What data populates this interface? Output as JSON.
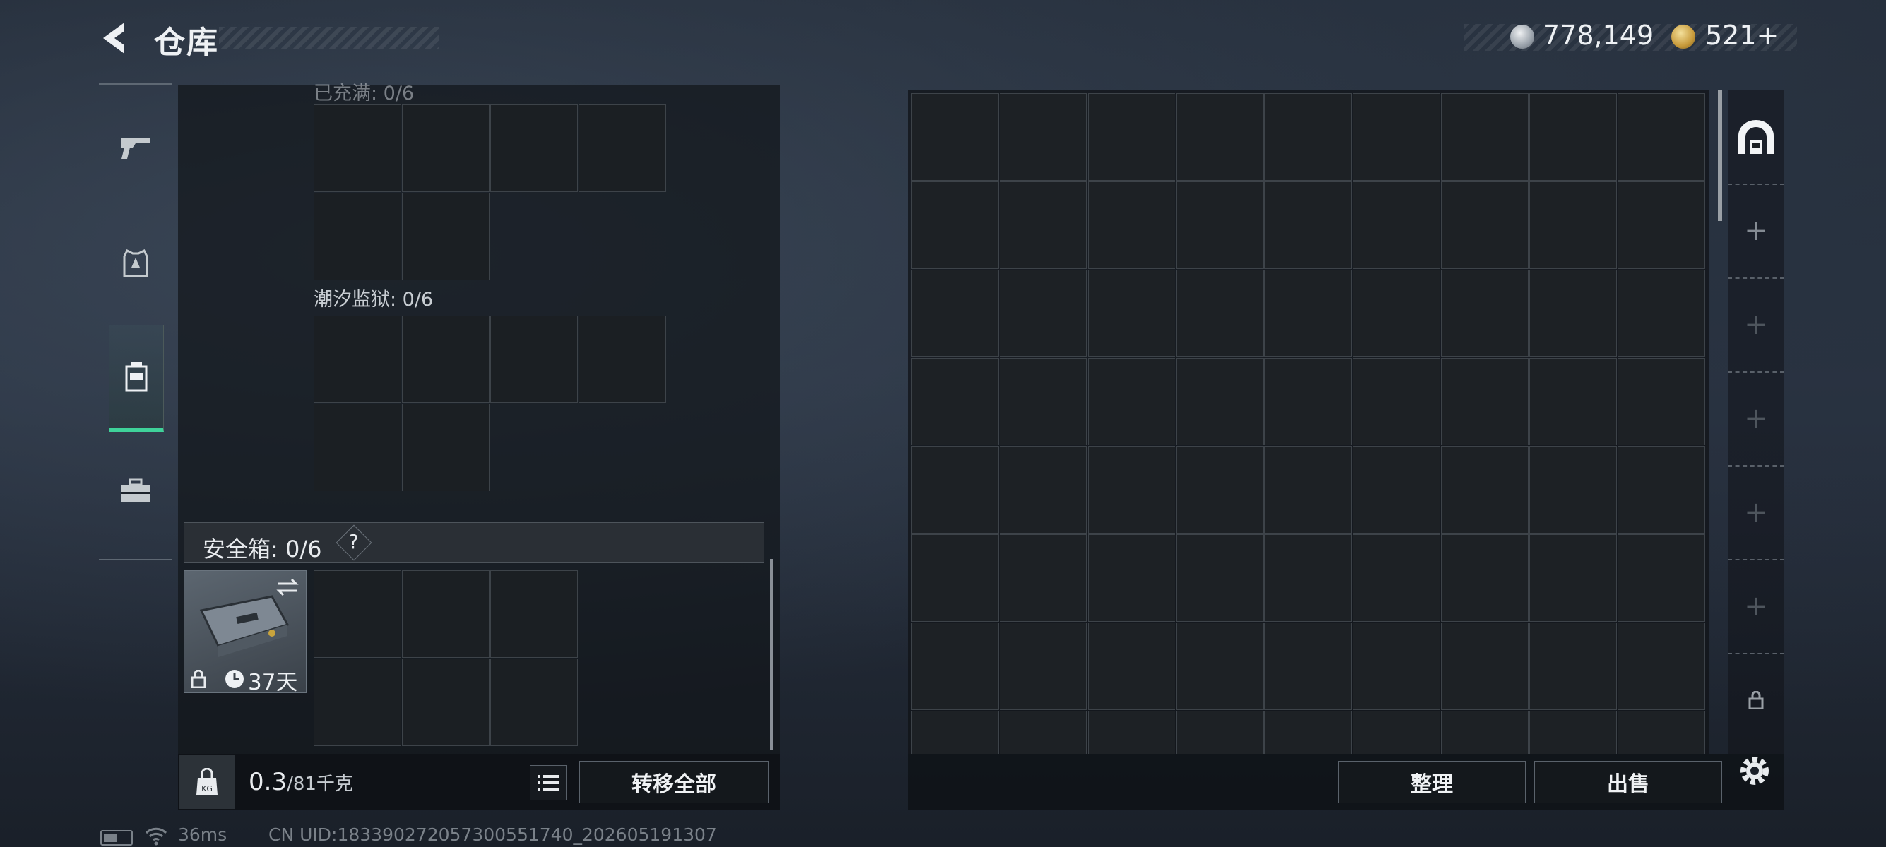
{
  "header": {
    "title": "仓库"
  },
  "currency": {
    "silver_amount": "778,149",
    "gold_amount": "521+"
  },
  "left_nav": {
    "items": [
      {
        "name": "weapon",
        "icon": "pistol-icon"
      },
      {
        "name": "armor",
        "icon": "armor-vest-icon"
      },
      {
        "name": "backpack",
        "icon": "backpack-icon",
        "active": true
      },
      {
        "name": "case",
        "icon": "toolbox-icon"
      }
    ]
  },
  "containers": [
    {
      "label": "已充满: 0/6"
    },
    {
      "label": "潮汐监狱: 0/6"
    }
  ],
  "safe_box": {
    "title": "安全箱: 0/6",
    "help": "?",
    "item_days": "37天",
    "swap_icon": "swap-icon",
    "lock_icon": "lock-icon",
    "clock_icon": "clock-icon"
  },
  "weight": {
    "current": "0.3",
    "max": "/81",
    "unit": "千克"
  },
  "buttons": {
    "transfer_all": "转移全部",
    "sort": "整理",
    "sell": "出售"
  },
  "side_tabs": [
    "safehouse-icon",
    "plus-icon",
    "plus-icon",
    "plus-icon",
    "plus-icon",
    "plus-icon",
    "lock-icon"
  ],
  "status": {
    "ping": "36ms",
    "uid": "CN UID:183390272057300551740_202605191307"
  },
  "colors": {
    "accent": "#3fd29a",
    "panel": "#1b1f23",
    "grid_line": "#3d4349"
  }
}
